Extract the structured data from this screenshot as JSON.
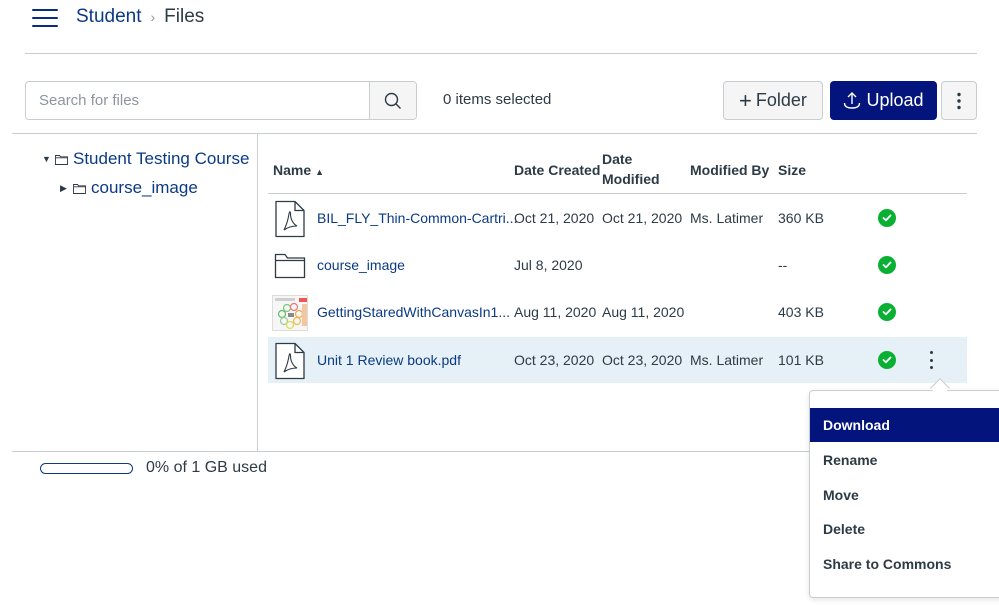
{
  "header": {
    "menu_icon": "hamburger-icon",
    "breadcrumb": [
      {
        "label": "Student",
        "link": true
      },
      {
        "label": "Files",
        "link": false
      }
    ],
    "separator": "›"
  },
  "toolbar": {
    "search_placeholder": "Search for files",
    "search_value": "",
    "search_icon": "search-icon",
    "items_selected": "0 items selected",
    "folder_button": {
      "icon": "plus-icon",
      "label": "Folder"
    },
    "upload_button": {
      "icon": "upload-icon",
      "label": "Upload"
    },
    "more_button": {
      "icon": "kebab-icon",
      "label": "⋮"
    }
  },
  "tree": {
    "root": {
      "label": "Student Testing Course",
      "expanded": true,
      "toggle": "▼"
    },
    "children": [
      {
        "label": "course_image",
        "expanded": false,
        "toggle": "▶"
      }
    ]
  },
  "table": {
    "columns": [
      {
        "label": "Name",
        "sort": "▲"
      },
      {
        "label": "Date Created"
      },
      {
        "label": "Date Modified",
        "line1": "Date",
        "line2": "Modified"
      },
      {
        "label": "Modified By"
      },
      {
        "label": "Size"
      }
    ],
    "rows": [
      {
        "type": "pdf",
        "icon": "pdf-file-icon",
        "name": "BIL_FLY_Thin-Common-Cartri...",
        "created": "Oct 21, 2020",
        "modified": "Oct 21, 2020",
        "modified_by": "Ms. Latimer",
        "size": "360 KB",
        "published": true,
        "selected": false
      },
      {
        "type": "folder",
        "icon": "folder-icon",
        "name": "course_image",
        "created": "Jul 8, 2020",
        "modified": "",
        "modified_by": "",
        "size": "--",
        "published": true,
        "selected": false
      },
      {
        "type": "image",
        "icon": "image-thumbnail",
        "name": "GettingStaredWithCanvasIn1...",
        "created": "Aug 11, 2020",
        "modified": "Aug 11, 2020",
        "modified_by": "",
        "size": "403 KB",
        "published": true,
        "selected": false
      },
      {
        "type": "pdf",
        "icon": "pdf-file-icon",
        "name": "Unit 1 Review book.pdf",
        "created": "Oct 23, 2020",
        "modified": "Oct 23, 2020",
        "modified_by": "Ms. Latimer",
        "size": "101 KB",
        "published": true,
        "selected": true
      }
    ]
  },
  "context_menu": {
    "items": [
      {
        "label": "Download",
        "active": true
      },
      {
        "label": "Rename",
        "active": false
      },
      {
        "label": "Move",
        "active": false
      },
      {
        "label": "Delete",
        "active": false
      },
      {
        "label": "Share to Commons",
        "active": false
      }
    ]
  },
  "quota": {
    "used_percent": 0,
    "label": "0% of 1 GB used"
  },
  "colors": {
    "brand_primary": "#03157c",
    "link": "#0b3a85",
    "published_green": "#0ab034",
    "selected_row": "#e6f0f7",
    "text": "#2d3b45"
  }
}
